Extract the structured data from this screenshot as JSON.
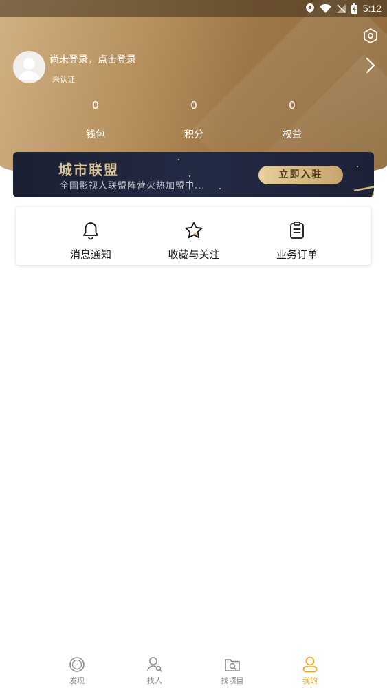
{
  "status_bar": {
    "time": "5:12"
  },
  "profile": {
    "login_prompt": "尚未登录，点击登录",
    "verification_status": "未认证"
  },
  "stats": [
    {
      "value": "0",
      "label": "钱包"
    },
    {
      "value": "0",
      "label": "积分"
    },
    {
      "value": "0",
      "label": "权益"
    }
  ],
  "banner": {
    "title": "城市联盟",
    "subtitle": "全国影视人联盟阵营火热加盟中...",
    "button_label": "立即入驻"
  },
  "quick_actions": [
    {
      "label": "消息通知",
      "icon": "bell-icon"
    },
    {
      "label": "收藏与关注",
      "icon": "star-icon"
    },
    {
      "label": "业务订单",
      "icon": "clipboard-icon"
    }
  ],
  "bottom_nav": [
    {
      "label": "发现",
      "icon": "compass-icon",
      "active": false
    },
    {
      "label": "找人",
      "icon": "person-search-icon",
      "active": false
    },
    {
      "label": "找项目",
      "icon": "folder-search-icon",
      "active": false
    },
    {
      "label": "我的",
      "icon": "user-icon",
      "active": true
    }
  ],
  "colors": {
    "header_gold": "#b7915f",
    "active_tab": "#f0a91f",
    "banner_navy": "#1f2440"
  }
}
